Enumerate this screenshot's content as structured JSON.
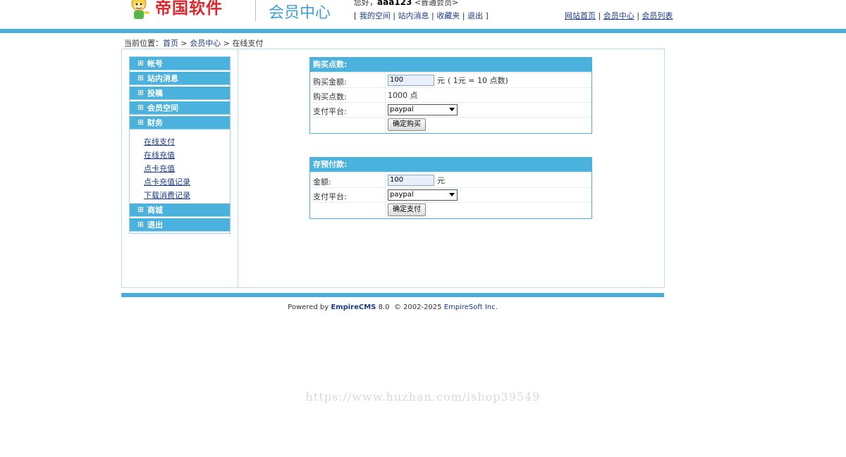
{
  "header": {
    "logo_text": "帝国软件",
    "center_title": "会员中心",
    "greeting_prefix": "您好，",
    "username": "aaa123",
    "user_group": "<普通会员>",
    "open_bracket": "[",
    "close_bracket": "]",
    "user_links": [
      "我的空间",
      "站内消息",
      "收藏夹",
      "退出"
    ],
    "top_links": [
      "网站首页",
      "会员中心",
      "会员列表"
    ],
    "separator": "|"
  },
  "breadcrumb": {
    "prefix": "当前位置：",
    "items": [
      "首页",
      "会员中心",
      "在线支付"
    ],
    "separator": " > "
  },
  "sidebar": {
    "menus": [
      {
        "label": "帐号"
      },
      {
        "label": "站内消息"
      },
      {
        "label": "投稿"
      },
      {
        "label": "会员空间"
      },
      {
        "label": "财务"
      },
      {
        "label": "商城"
      },
      {
        "label": "退出"
      }
    ],
    "finance_items": [
      "在线支付",
      "在线充值",
      "点卡充值",
      "点卡充值记录",
      "下载消费记录"
    ]
  },
  "buy_points": {
    "title": "购买点数:",
    "amount_label": "购买金额:",
    "amount_value": "100",
    "amount_unit": "元",
    "rate_hint": "( 1元 = 10 点数)",
    "points_label": "购买点数:",
    "points_value": "1000 点",
    "platform_label": "支付平台:",
    "platform_value": "paypal",
    "submit_label": "确定购买"
  },
  "prepay": {
    "title": "存预付款:",
    "amount_label": "金额:",
    "amount_value": "100",
    "amount_unit": "元",
    "platform_label": "支付平台:",
    "platform_value": "paypal",
    "submit_label": "确定支付"
  },
  "footer": {
    "powered_by": "Powered by",
    "brand": "EmpireCMS",
    "version": "8.0",
    "copyright": "© 2002-2025",
    "company": "EmpireSoft Inc."
  },
  "watermark": "https://www.huzhan.com/ishop39549",
  "colors": {
    "accent": "#4aaed9",
    "logo_red": "#e0262b",
    "link": "#1a3a8a"
  }
}
